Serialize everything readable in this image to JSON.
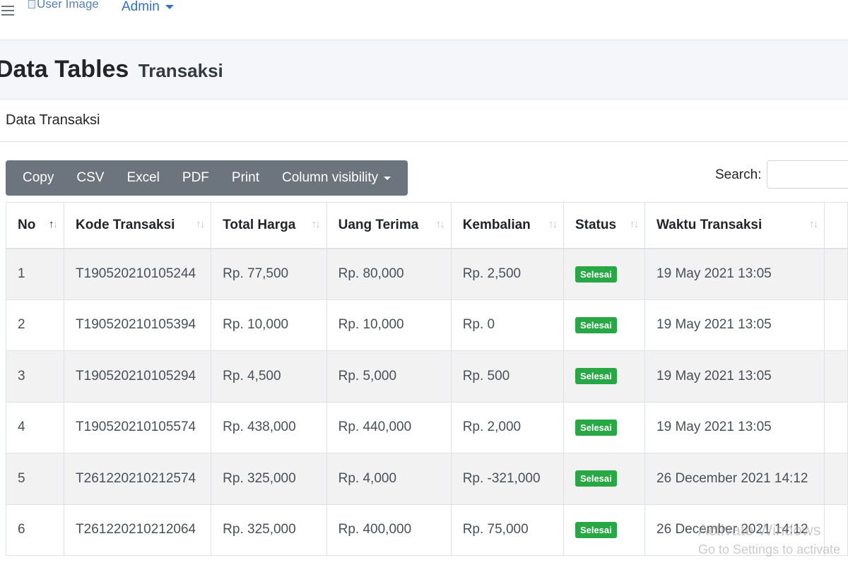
{
  "navbar": {
    "user_image_alt": "User Image",
    "admin_label": "Admin"
  },
  "header": {
    "title": "Data Tables",
    "subtitle": "Transaksi"
  },
  "card": {
    "title": "Data Transaksi"
  },
  "toolbar": {
    "buttons": [
      "Copy",
      "CSV",
      "Excel",
      "PDF",
      "Print",
      "Column visibility"
    ]
  },
  "search": {
    "label": "Search:",
    "value": ""
  },
  "table": {
    "columns": [
      "No",
      "Kode Transaksi",
      "Total Harga",
      "Uang Terima",
      "Kembalian",
      "Status",
      "Waktu Transaksi"
    ],
    "rows": [
      [
        "1",
        "T190520210105244",
        "Rp. 77,500",
        "Rp. 80,000",
        "Rp. 2,500",
        "Selesai",
        "19 May 2021 13:05"
      ],
      [
        "2",
        "T190520210105394",
        "Rp. 10,000",
        "Rp. 10,000",
        "Rp. 0",
        "Selesai",
        "19 May 2021 13:05"
      ],
      [
        "3",
        "T190520210105294",
        "Rp. 4,500",
        "Rp. 5,000",
        "Rp. 500",
        "Selesai",
        "19 May 2021 13:05"
      ],
      [
        "4",
        "T190520210105574",
        "Rp. 438,000",
        "Rp. 440,000",
        "Rp. 2,000",
        "Selesai",
        "19 May 2021 13:05"
      ],
      [
        "5",
        "T261220210212574",
        "Rp. 325,000",
        "Rp. 4,000",
        "Rp. -321,000",
        "Selesai",
        "26 December 2021 14:12"
      ],
      [
        "6",
        "T261220210212064",
        "Rp. 325,000",
        "Rp. 400,000",
        "Rp. 75,000",
        "Selesai",
        "26 December 2021 14:12"
      ]
    ]
  },
  "watermark": {
    "line1": "Activate Windows",
    "line2": "Go to Settings to activate"
  },
  "colors": {
    "badge": "#28a745",
    "toolbar": "#6c757d",
    "link": "#2f6fcf"
  }
}
